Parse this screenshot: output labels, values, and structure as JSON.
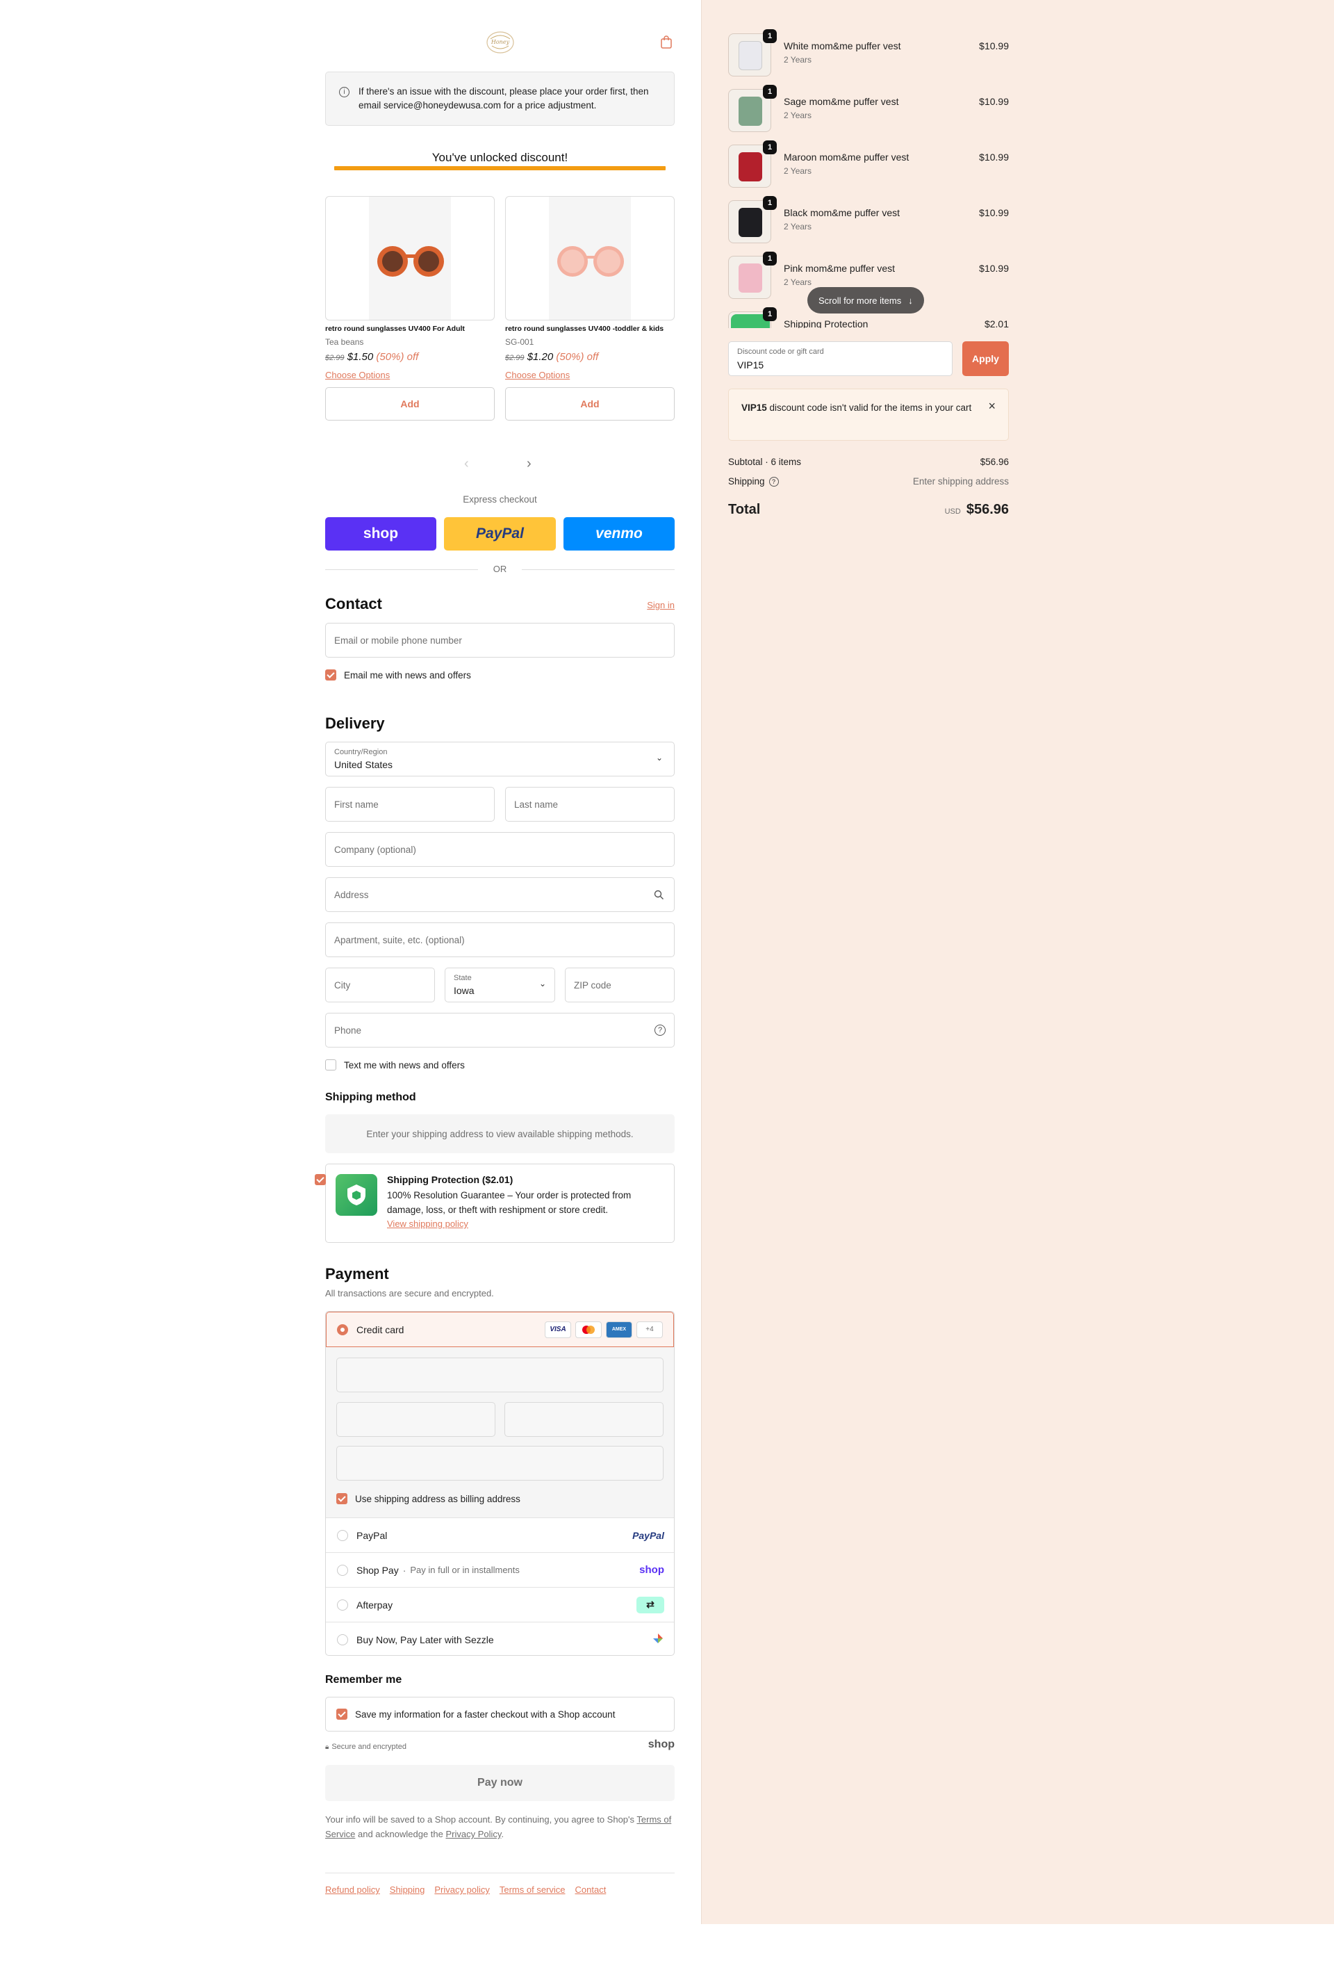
{
  "header": {
    "logo_alt": "Honey Dew",
    "cart_icon": "shopping-bag-icon"
  },
  "notice": {
    "text": "If there's an issue with the discount, please place your order first, then email service@honeydewusa.com for a price adjustment."
  },
  "discount_banner": {
    "text": "You've unlocked discount!",
    "progress": 1.0
  },
  "upsell": {
    "products": [
      {
        "name": "retro round sunglasses UV400 For Adult",
        "vendor": "Tea beans",
        "old_price": "$2.99",
        "price": "$1.50",
        "discount": "(50%) off",
        "options_label": "Choose Options",
        "add_label": "Add"
      },
      {
        "name": "retro round sunglasses UV400 -toddler & kids",
        "vendor": "SG-001",
        "old_price": "$2.99",
        "price": "$1.20",
        "discount": "(50%) off",
        "options_label": "Choose Options",
        "add_label": "Add"
      }
    ]
  },
  "express": {
    "title": "Express checkout",
    "shop": "shop",
    "paypal": "PayPal",
    "venmo": "venmo",
    "or": "OR"
  },
  "contact": {
    "title": "Contact",
    "sign_in": "Sign in",
    "email_placeholder": "Email or mobile phone number",
    "news_label": "Email me with news and offers"
  },
  "delivery": {
    "title": "Delivery",
    "country_label": "Country/Region",
    "country_value": "United States",
    "first_name": "First name",
    "last_name": "Last name",
    "company": "Company (optional)",
    "address": "Address",
    "apartment": "Apartment, suite, etc. (optional)",
    "city": "City",
    "state_label": "State",
    "state_value": "Iowa",
    "zip": "ZIP code",
    "phone": "Phone",
    "text_label": "Text me with news and offers"
  },
  "shipping_method": {
    "title": "Shipping method",
    "message": "Enter your shipping address to view available shipping methods."
  },
  "protection": {
    "title": "Shipping Protection ($2.01)",
    "text": "100% Resolution Guarantee – Your order is protected from damage, loss, or theft with reshipment or store credit.",
    "link": "View shipping policy"
  },
  "payment": {
    "title": "Payment",
    "subtitle": "All transactions are secure and encrypted.",
    "credit_card": "Credit card",
    "more_cards": "+4",
    "billing_label": "Use shipping address as billing address",
    "paypal": "PayPal",
    "shop_pay": "Shop Pay",
    "shop_pay_note": "Pay in full or in installments",
    "afterpay": "Afterpay",
    "sezzle": "Buy Now, Pay Later with Sezzle"
  },
  "remember": {
    "title": "Remember me",
    "save_label": "Save my information for a faster checkout with a Shop account",
    "secure": "Secure and encrypted",
    "shop": "shop"
  },
  "pay_now": "Pay now",
  "legal": {
    "prefix": "Your info will be saved to a Shop account. By continuing, you agree to Shop's",
    "terms": "Terms of Service",
    "middle": "and acknowledge the",
    "privacy": "Privacy Policy",
    "end": "."
  },
  "footer": [
    "Refund policy",
    "Shipping",
    "Privacy policy",
    "Terms of service",
    "Contact"
  ],
  "summary": {
    "items": [
      {
        "name": "White mom&me puffer vest",
        "variant": "2 Years",
        "price": "$10.99",
        "qty": "1",
        "color": "#e9e9ee"
      },
      {
        "name": "Sage mom&me puffer vest",
        "variant": "2 Years",
        "price": "$10.99",
        "qty": "1",
        "color": "#7fa58a"
      },
      {
        "name": "Maroon mom&me puffer vest",
        "variant": "2 Years",
        "price": "$10.99",
        "qty": "1",
        "color": "#b3202c"
      },
      {
        "name": "Black mom&me puffer vest",
        "variant": "2 Years",
        "price": "$10.99",
        "qty": "1",
        "color": "#1e1e22"
      },
      {
        "name": "Pink mom&me puffer vest",
        "variant": "2 Years",
        "price": "$10.99",
        "qty": "1",
        "color": "#f1b9c6"
      },
      {
        "name": "Shipping Protection",
        "variant": "",
        "price": "$2.01",
        "qty": "1",
        "color": "#3dbf6c"
      }
    ],
    "scroll_hint": "Scroll for more items",
    "discount_label": "Discount code or gift card",
    "discount_value": "VIP15",
    "apply": "Apply",
    "error_code": "VIP15",
    "error_text": "discount code isn't valid for the items in your cart",
    "subtotal_label": "Subtotal · 6 items",
    "subtotal_value": "$56.96",
    "shipping_label": "Shipping",
    "shipping_value": "Enter shipping address",
    "total_label": "Total",
    "currency": "USD",
    "total_value": "$56.96"
  }
}
